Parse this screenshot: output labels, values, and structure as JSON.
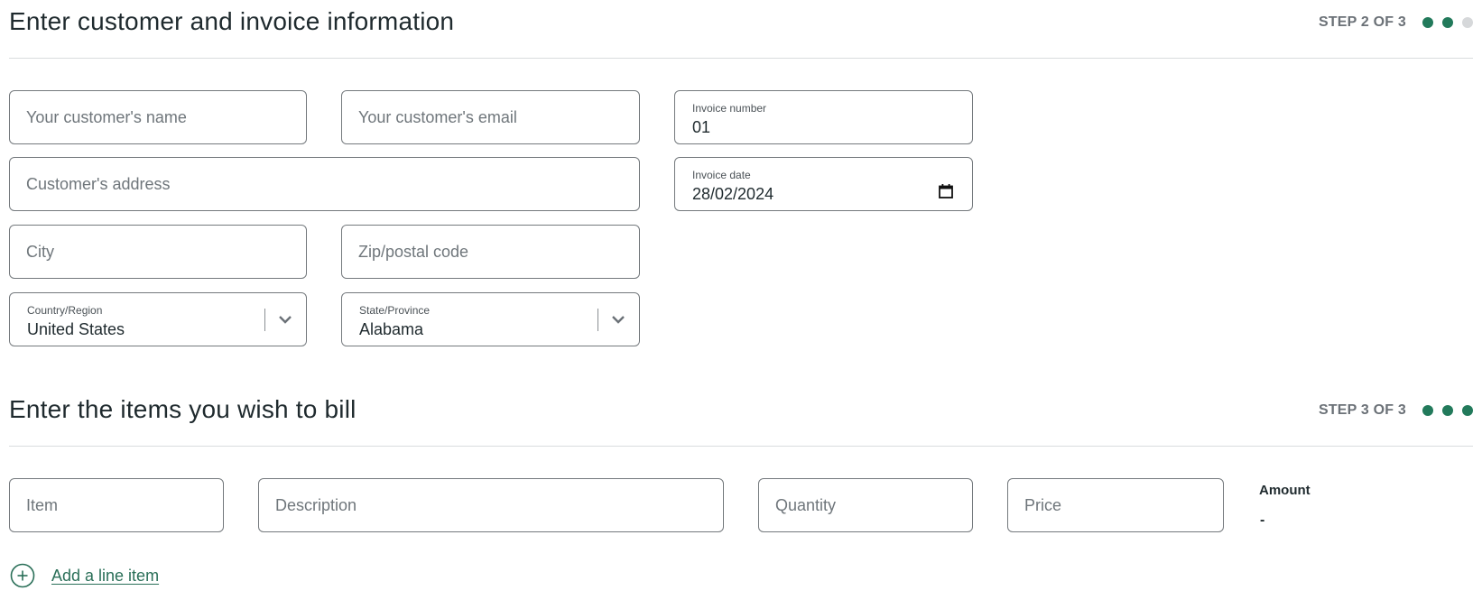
{
  "section_customer": {
    "title": "Enter customer and invoice information",
    "step_label": "STEP 2 OF 3",
    "steps_total": 3,
    "steps_completed": 2,
    "fields": {
      "customer_name": {
        "placeholder": "Your customer's name",
        "value": ""
      },
      "customer_email": {
        "placeholder": "Your customer's email",
        "value": ""
      },
      "invoice_number": {
        "label": "Invoice number",
        "value": "01"
      },
      "customer_address": {
        "placeholder": "Customer's address",
        "value": ""
      },
      "invoice_date": {
        "label": "Invoice date",
        "value": "28/02/2024"
      },
      "city": {
        "placeholder": "City",
        "value": ""
      },
      "zip": {
        "placeholder": "Zip/postal code",
        "value": ""
      },
      "country": {
        "label": "Country/Region",
        "value": "United States"
      },
      "state": {
        "label": "State/Province",
        "value": "Alabama"
      }
    }
  },
  "section_items": {
    "title": "Enter the items you wish to bill",
    "step_label": "STEP 3 OF 3",
    "steps_total": 3,
    "steps_completed": 3,
    "line_item": {
      "item": {
        "placeholder": "Item",
        "value": ""
      },
      "description": {
        "placeholder": "Description",
        "value": ""
      },
      "quantity": {
        "placeholder": "Quantity",
        "value": ""
      },
      "price": {
        "placeholder": "Price",
        "value": ""
      },
      "amount_label": "Amount",
      "amount_value": "-"
    },
    "add_line_item_label": "Add a line item"
  },
  "colors": {
    "accent": "#227a5b",
    "step_inactive": "#d6d8da",
    "link": "#2a6f58"
  },
  "icons": {
    "step_dot": "filled-circle",
    "select_chevron": "chevron-down-icon",
    "date_picker": "calendar-icon",
    "add": "plus-circle-icon"
  }
}
